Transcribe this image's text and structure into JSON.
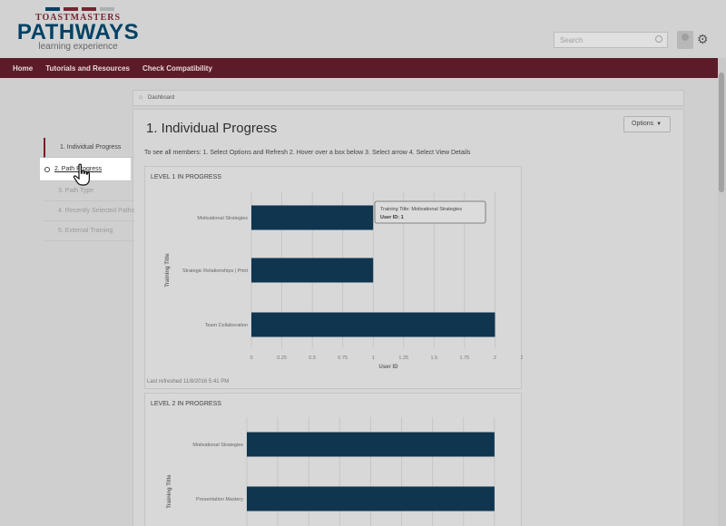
{
  "header": {
    "logo": {
      "top": "TOASTMASTERS",
      "main": "PATHWAYS",
      "sub": "learning experience",
      "bar_colors": [
        "#004165",
        "#772432",
        "#772432",
        "#a9b2b1"
      ]
    },
    "search_placeholder": "Search"
  },
  "nav": {
    "items": [
      "Home",
      "Tutorials and Resources",
      "Check Compatibility"
    ]
  },
  "breadcrumb": {
    "label": "Dashboard"
  },
  "sidebar": {
    "items": [
      {
        "label": "1. Individual Progress"
      },
      {
        "label": "2. Path Progress"
      },
      {
        "label": "3. Path Type"
      },
      {
        "label": "4. Recently Selected Paths"
      },
      {
        "label": "5. External Training"
      }
    ]
  },
  "main": {
    "title": "1. Individual Progress",
    "options_label": "Options",
    "instructions": "To see all members: 1. Select Options and Refresh 2. Hover over a box below 3. Select arrow 4. Select View Details",
    "refreshed": "Last refreshed 11/8/2016 5:41 PM"
  },
  "colors": {
    "bar": "#10354f",
    "nav": "#5c1c27",
    "brand_blue": "#004165",
    "brand_red": "#772432"
  },
  "chart_data": [
    {
      "type": "bar",
      "title": "LEVEL 1 IN PROGRESS",
      "categories": [
        "Motivational Strategies",
        "Strategic Relationships | Print",
        "Team Collaboration"
      ],
      "values": [
        1,
        1,
        2
      ],
      "xlabel": "User ID",
      "ylabel": "Training Title",
      "xlim": [
        0,
        2.25
      ],
      "ticks": [
        "0",
        "0.25",
        "0.5",
        "0.75",
        "1",
        "1.25",
        "1.5",
        "1.75",
        "2",
        "2.25"
      ],
      "tooltip": {
        "line1": "Training Title: Motivational Strategies",
        "line2": "User ID: 1"
      }
    },
    {
      "type": "bar",
      "title": "LEVEL 2 IN PROGRESS",
      "categories": [
        "Motivational Strategies",
        "Presentation Mastery"
      ],
      "values": [
        2,
        2
      ],
      "ylabel": "Training Title",
      "xlim": [
        0,
        2.25
      ]
    }
  ]
}
